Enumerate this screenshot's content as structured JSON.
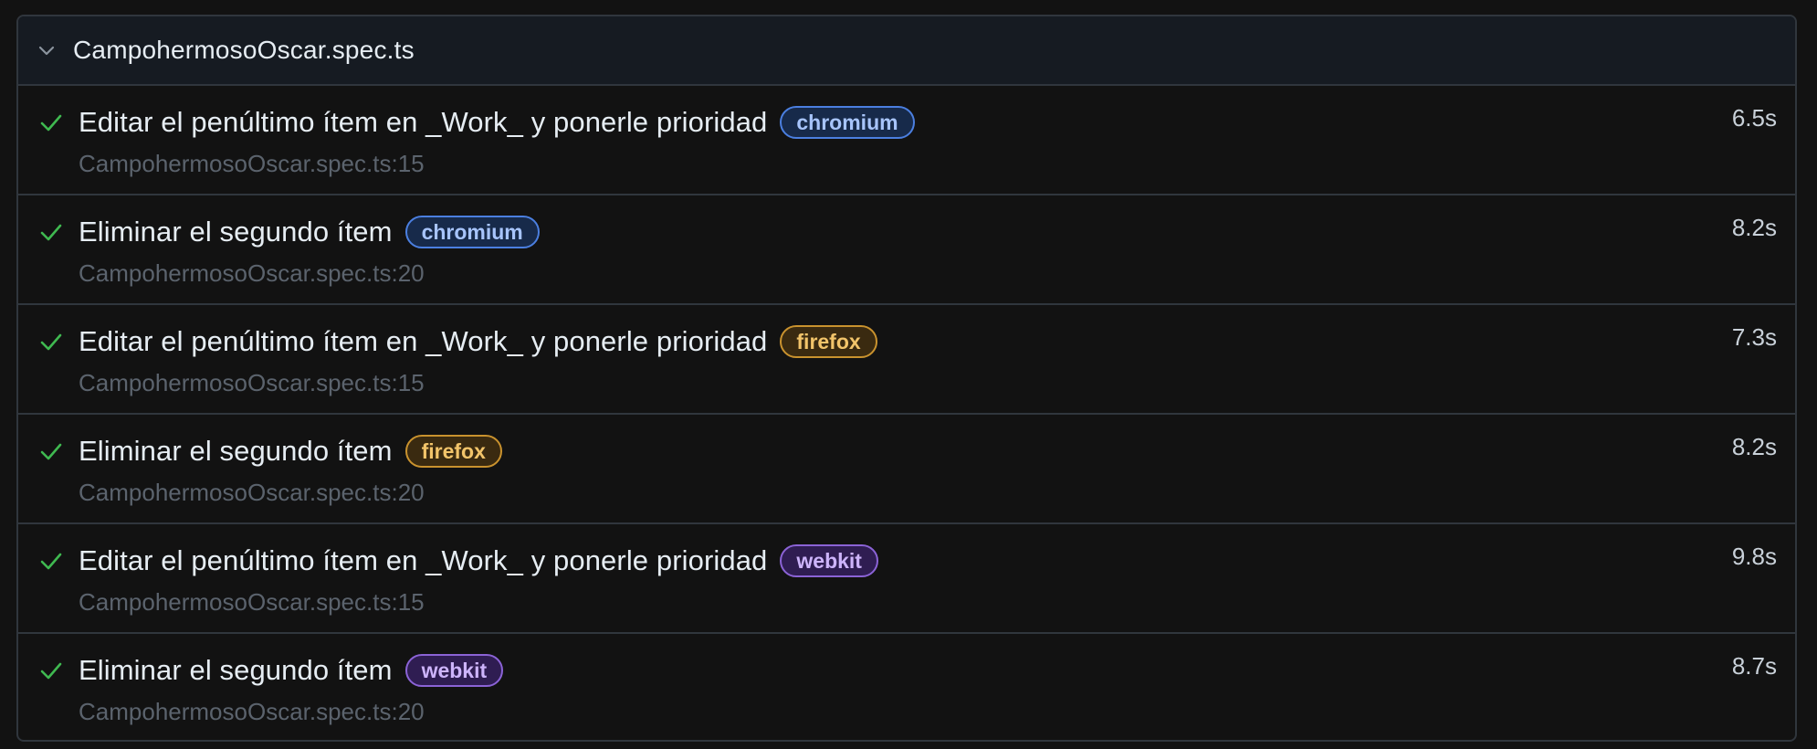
{
  "suite": {
    "file_name": "CampohermosoOscar.spec.ts",
    "expanded_icon": "chevron-down-icon"
  },
  "colors": {
    "pass_check": "#3fb950",
    "chromium": "#4b7fe0",
    "firefox": "#c9922e",
    "webkit": "#8b63d6"
  },
  "tests": [
    {
      "title": "Editar el penúltimo ítem en _Work_ y ponerle prioridad",
      "project": "chromium",
      "location": "CampohermosoOscar.spec.ts:15",
      "duration": "6.5s",
      "status_icon": "check-icon"
    },
    {
      "title": "Eliminar el segundo ítem",
      "project": "chromium",
      "location": "CampohermosoOscar.spec.ts:20",
      "duration": "8.2s",
      "status_icon": "check-icon"
    },
    {
      "title": "Editar el penúltimo ítem en _Work_ y ponerle prioridad",
      "project": "firefox",
      "location": "CampohermosoOscar.spec.ts:15",
      "duration": "7.3s",
      "status_icon": "check-icon"
    },
    {
      "title": "Eliminar el segundo ítem",
      "project": "firefox",
      "location": "CampohermosoOscar.spec.ts:20",
      "duration": "8.2s",
      "status_icon": "check-icon"
    },
    {
      "title": "Editar el penúltimo ítem en _Work_ y ponerle prioridad",
      "project": "webkit",
      "location": "CampohermosoOscar.spec.ts:15",
      "duration": "9.8s",
      "status_icon": "check-icon"
    },
    {
      "title": "Eliminar el segundo ítem",
      "project": "webkit",
      "location": "CampohermosoOscar.spec.ts:20",
      "duration": "8.7s",
      "status_icon": "check-icon"
    }
  ]
}
